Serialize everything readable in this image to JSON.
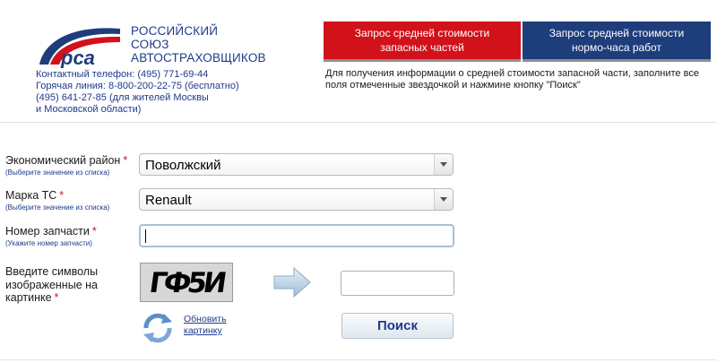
{
  "brand": {
    "logo_text": "рса",
    "name_lines": [
      "РОССИЙСКИЙ",
      "СОЮЗ",
      "АВТОСТРАХОВЩИКОВ"
    ]
  },
  "contacts": {
    "lines": [
      "Контактный телефон:  (495) 771-69-44",
      "Горячая линия:  8-800-200-22-75  (бесплатно)",
      "(495) 641-27-85 (для жителей Москвы",
      "и Московской области)"
    ]
  },
  "tabs": [
    {
      "line1": "Запрос средней стоимости",
      "line2": "запасных частей",
      "color": "#d2121b",
      "active": true
    },
    {
      "line1": "Запрос средней стоимости",
      "line2": "нормо-часа работ",
      "color": "#1e3d7b",
      "active": false
    }
  ],
  "instruction": "Для получения информации о средней стоимости запасной части, заполните все поля отмеченные звездочкой и нажмине кнопку \"Поиск\"",
  "form": {
    "required_mark": "*",
    "region": {
      "label": "Экономический район",
      "hint": "(Выберите значение из списка)",
      "value": "Поволжский"
    },
    "brand": {
      "label": "Марка ТС",
      "hint": "(Выберите значение из списка)",
      "value": "Renault"
    },
    "part_number": {
      "label": "Номер запчасти",
      "hint": "(Укажите номер запчасти)",
      "value": ""
    },
    "captcha": {
      "label_lines": [
        "Введите символы",
        "изображенные на",
        "картинке"
      ],
      "image_text": "ГФ5И",
      "value": "",
      "refresh_label_lines": [
        "Обновить",
        "картинку"
      ]
    },
    "search_label": "Поиск"
  },
  "colors": {
    "brand_red": "#d2121b",
    "brand_blue": "#1e3d7b",
    "link_blue": "#1f3a8a"
  }
}
